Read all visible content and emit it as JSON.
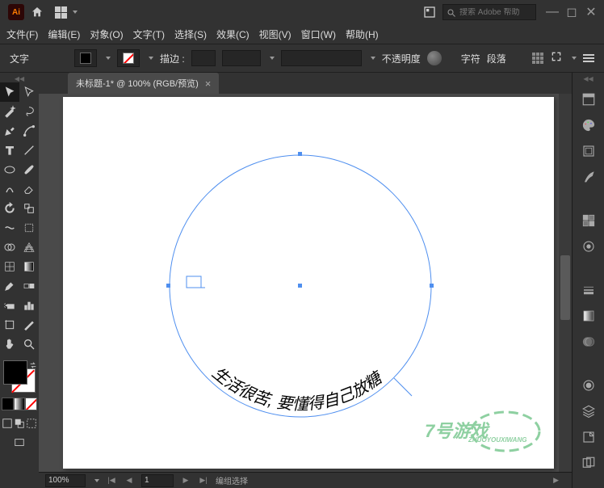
{
  "app": {
    "logo_text": "Ai",
    "search_placeholder": "搜索 Adobe 帮助"
  },
  "menus": {
    "file": "文件(F)",
    "edit": "编辑(E)",
    "object": "对象(O)",
    "type": "文字(T)",
    "select": "选择(S)",
    "effect": "效果(C)",
    "view": "视图(V)",
    "window": "窗口(W)",
    "help": "帮助(H)"
  },
  "control": {
    "context_label": "文字",
    "stroke_label": "描边 :",
    "opacity_label": "不透明度",
    "character_label": "字符",
    "paragraph_label": "段落",
    "stroke_weight": ""
  },
  "document": {
    "tab_title": "未标题-1* @ 100% (RGB/预览)"
  },
  "canvas": {
    "path_text": "生活很苦, 要懂得自己放糖"
  },
  "status": {
    "zoom": "100%",
    "artboard_nav": "1",
    "selection_info": "编组选择"
  },
  "watermark": {
    "line1": "7号游戏",
    "line2": "ZHUOYOUXIWANG"
  }
}
